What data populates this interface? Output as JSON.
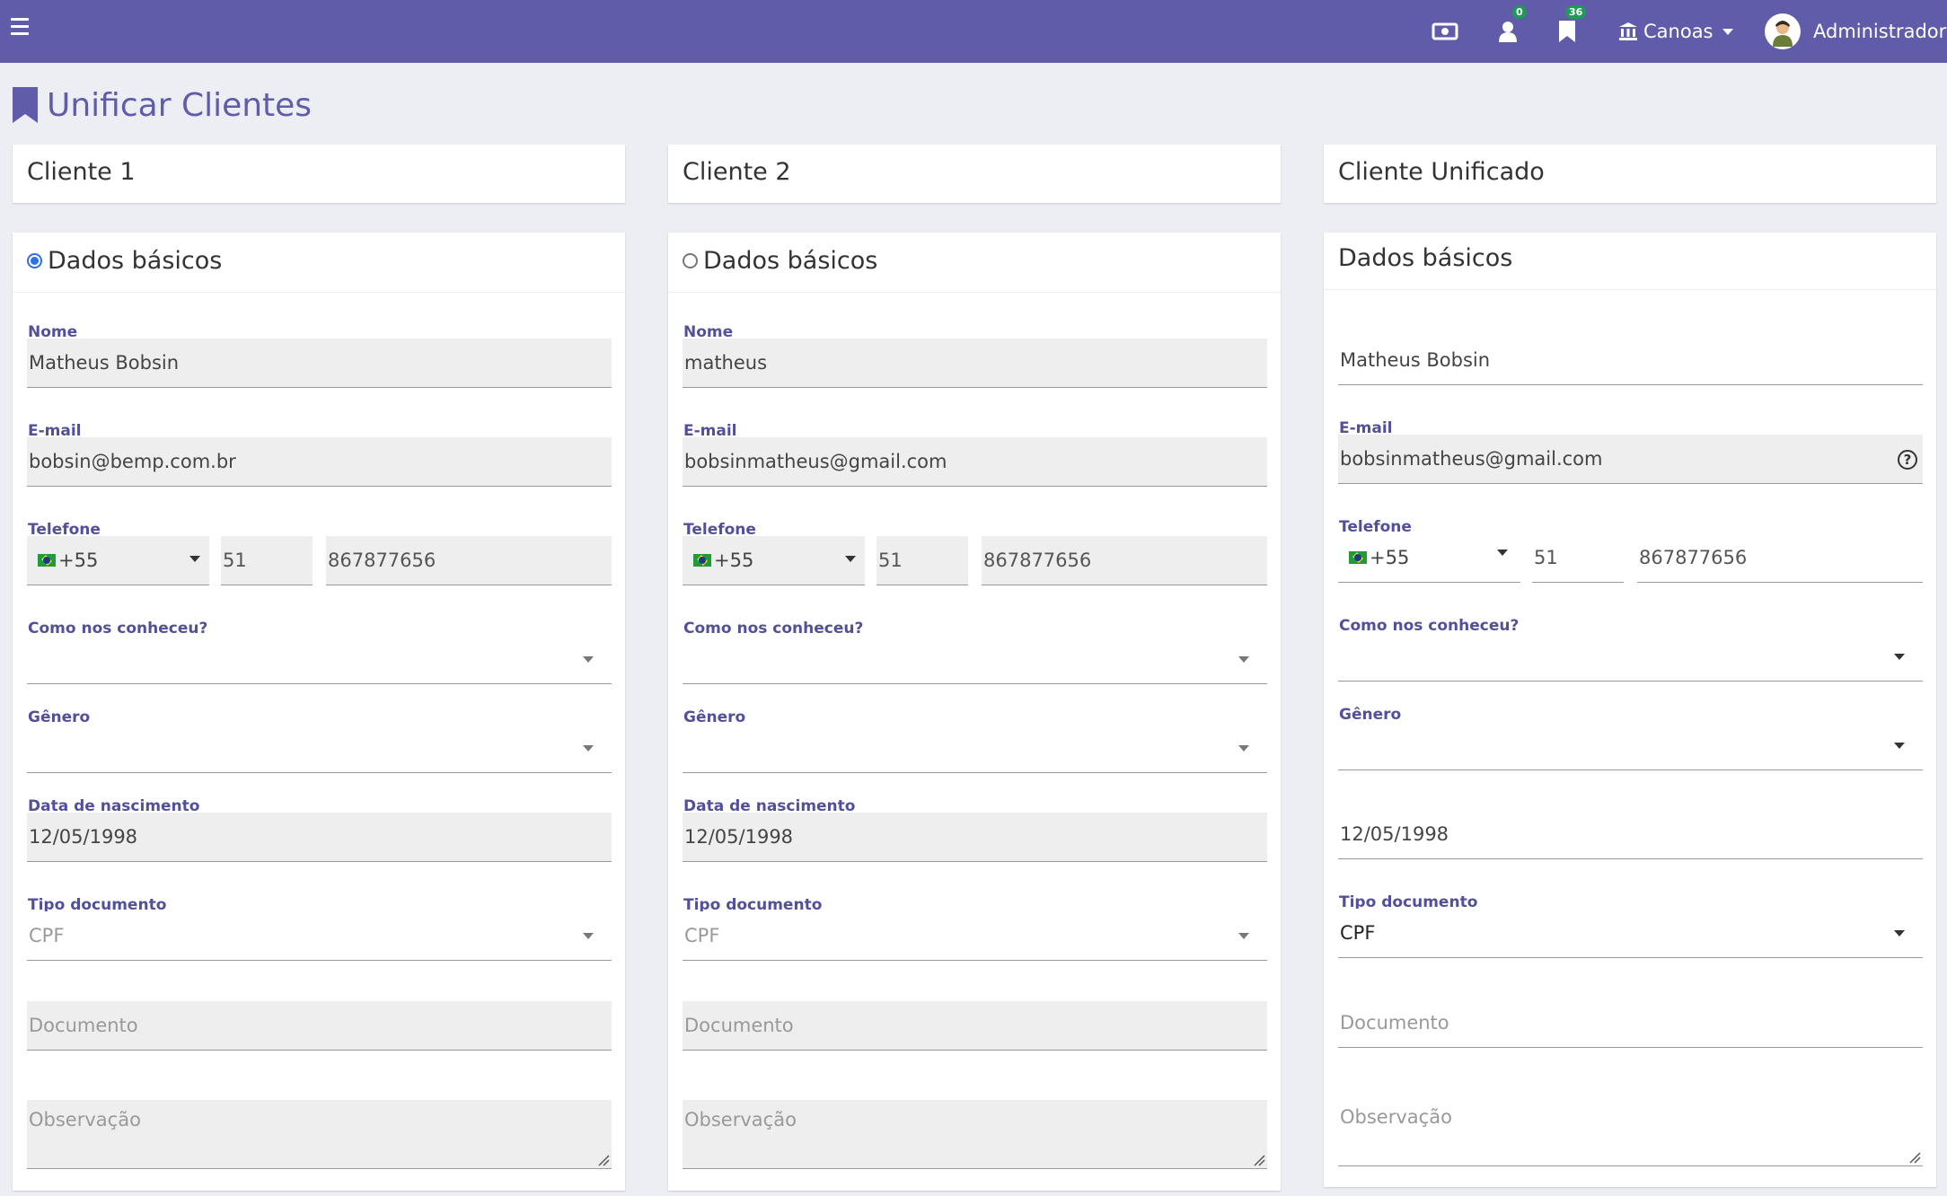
{
  "topbar": {
    "badge_users": "0",
    "badge_bookmarks": "36",
    "store_label": "Canoas",
    "user_name": "Administrador"
  },
  "page": {
    "title": "Unificar Clientes"
  },
  "columns": [
    {
      "header": "Cliente 1",
      "section_title": "Dados básicos",
      "selected": true,
      "nome_label": "Nome",
      "nome": "Matheus Bobsin",
      "email_label": "E-mail",
      "email": "bobsin@bemp.com.br",
      "telefone_label": "Telefone",
      "ddi": "+55",
      "ddd": "51",
      "telefone": "867877656",
      "como_label": "Como nos conheceu?",
      "genero_label": "Gênero",
      "nasc_label": "Data de nascimento",
      "nascimento": "12/05/1998",
      "tipo_label": "Tipo documento",
      "tipo": "CPF",
      "documento_placeholder": "Documento",
      "observacao_placeholder": "Observação"
    },
    {
      "header": "Cliente 2",
      "section_title": "Dados básicos",
      "selected": false,
      "nome_label": "Nome",
      "nome": "matheus",
      "email_label": "E-mail",
      "email": "bobsinmatheus@gmail.com",
      "telefone_label": "Telefone",
      "ddi": "+55",
      "ddd": "51",
      "telefone": "867877656",
      "como_label": "Como nos conheceu?",
      "genero_label": "Gênero",
      "nasc_label": "Data de nascimento",
      "nascimento": "12/05/1998",
      "tipo_label": "Tipo documento",
      "tipo": "CPF",
      "documento_placeholder": "Documento",
      "observacao_placeholder": "Observação"
    },
    {
      "header": "Cliente Unificado",
      "section_title": "Dados básicos",
      "nome": "Matheus Bobsin",
      "email_label": "E-mail",
      "email": "bobsinmatheus@gmail.com",
      "telefone_label": "Telefone",
      "ddi": "+55",
      "ddd": "51",
      "telefone": "867877656",
      "como_label": "Como nos conheceu?",
      "genero_label": "Gênero",
      "nascimento": "12/05/1998",
      "tipo_label": "Tipo documento",
      "tipo": "CPF",
      "documento_placeholder": "Documento",
      "observacao_placeholder": "Observação"
    }
  ],
  "colors": {
    "primary": "#615ca9",
    "badge": "#1e9b55",
    "label": "#53509b",
    "radio": "#2f6fe4"
  }
}
